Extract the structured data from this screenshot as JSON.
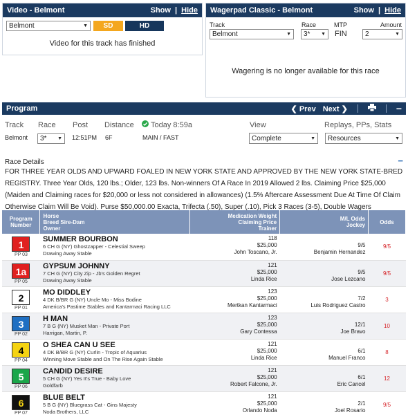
{
  "video": {
    "title": "Video - Belmont",
    "show": "Show",
    "sep": "|",
    "hide": "Hide",
    "track_select": "Belmont",
    "sd": "SD",
    "hd": "HD",
    "status": "Video for this track has finished"
  },
  "wager": {
    "title": "Wagerpad Classic - Belmont",
    "show": "Show",
    "sep": "|",
    "hide": "Hide",
    "track_label": "Track",
    "track_value": "Belmont",
    "race_label": "Race",
    "race_value": "3*",
    "mtp_label": "MTP",
    "mtp_value": "FIN",
    "amount_label": "Amount",
    "amount_value": "2",
    "status": "Wagering is no longer available for this race"
  },
  "program": {
    "title": "Program",
    "prev": "Prev",
    "next": "Next",
    "track_label": "Track",
    "race_label": "Race",
    "post_label": "Post",
    "distance_label": "Distance",
    "today_label": "Today 8:59a",
    "view_label": "View",
    "replays_label": "Replays, PPs, Stats",
    "track_value": "Belmont",
    "race_value": "3*",
    "post_value": "12:51PM",
    "distance_value": "6F",
    "surface_value": "MAIN / FAST",
    "view_value": "Complete",
    "resources_value": "Resources",
    "details_title": "Race Details",
    "details_lines": [
      "FOR THREE YEAR OLDS AND UPWARD FOALED IN NEW YORK STATE AND APPROVED BY THE NEW YORK STATE-BRED",
      "REGISTRY. Three Year Olds, 120 lbs.; Older, 123 lbs. Non-winners Of A Race In 2019 Allowed 2 lbs. Claiming Price $25,000",
      "(Maiden and Claiming races for $20,000 or less not considered in allowances) (1.5% Aftercare Assessment Due At Time Of Claim",
      "Otherwise Claim Will Be Void). Purse $50,000.00 Exacta, Trifecta (.50), Super (.10), Pick 3 Races (3-5), Double Wagers"
    ],
    "headers": {
      "program": "Program",
      "number": "Number",
      "horse": "Horse",
      "breed": "Breed Sire-Dam",
      "owner": "Owner",
      "med": "Medication Weight",
      "claim": "Claiming Price",
      "trainer": "Trainer",
      "ml": "M/L Odds",
      "jockey": "Jockey",
      "odds": "Odds"
    },
    "entries": [
      {
        "num": "1",
        "pp": "PP 03",
        "name": "SUMMER BOURBON",
        "breed": "6 CH G (NY) Ghostzapper - Celestial Sweep",
        "owner": "Drawing Away Stable",
        "weight": "118",
        "claim": "$25,000",
        "trainer": "John Toscano, Jr.",
        "ml": "9/5",
        "jockey": "Benjamin Hernandez",
        "odds": "9/5",
        "bg": "#e0201f",
        "fg": "#ffffff"
      },
      {
        "num": "1a",
        "pp": "PP 05",
        "name": "GYPSUM JOHNNY",
        "breed": "7 CH G (NY) City Zip - Jb's Golden Regret",
        "owner": "Drawing Away Stable",
        "weight": "121",
        "claim": "$25,000",
        "trainer": "Linda Rice",
        "ml": "9/5",
        "jockey": "Jose Lezcano",
        "odds": "9/5",
        "bg": "#e0201f",
        "fg": "#ffffff"
      },
      {
        "num": "2",
        "pp": "PP 01",
        "name": "MO DIDDLEY",
        "breed": "4 DK B/BR G (NY) Uncle Mo - Miss Bodine",
        "owner": "America's Pastime Stables and Kantarmaci Racing LLC",
        "weight": "123",
        "claim": "$25,000",
        "trainer": "Mertkan Kantarmaci",
        "ml": "7/2",
        "jockey": "Luis Rodriguez Castro",
        "odds": "3",
        "bg": "#ffffff",
        "fg": "#000000"
      },
      {
        "num": "3",
        "pp": "PP 02",
        "name": "H MAN",
        "breed": "7 B G (NY) Musket Man - Private Port",
        "owner": "Harrigan, Martin, P.",
        "weight": "123",
        "claim": "$25,000",
        "trainer": "Gary Contessa",
        "ml": "12/1",
        "jockey": "Joe Bravo",
        "odds": "10",
        "bg": "#1f6fc2",
        "fg": "#ffffff"
      },
      {
        "num": "4",
        "pp": "PP 04",
        "name": "O SHEA CAN U SEE",
        "breed": "4 DK B/BR G (NY) Curlin - Tropic of Aquarius",
        "owner": "Winning Move Stable and On The Rise Again Stable",
        "weight": "121",
        "claim": "$25,000",
        "trainer": "Linda Rice",
        "ml": "6/1",
        "jockey": "Manuel Franco",
        "odds": "8",
        "bg": "#f5d312",
        "fg": "#000000"
      },
      {
        "num": "5",
        "pp": "PP 06",
        "name": "CANDID DESIRE",
        "breed": "5 CH G (NY) Yes It's True - Baby Love",
        "owner": "Goldfarb",
        "weight": "121",
        "claim": "$25,000",
        "trainer": "Robert Falcone, Jr.",
        "ml": "6/1",
        "jockey": "Eric Cancel",
        "odds": "12",
        "bg": "#1aa64a",
        "fg": "#ffffff"
      },
      {
        "num": "6",
        "pp": "PP 07",
        "name": "BLUE BELT",
        "breed": "5 B G (NY) Bluegrass Cat - Gins Majesty",
        "owner": "Noda Brothers, LLC",
        "weight": "121",
        "claim": "$25,000",
        "trainer": "Orlando Noda",
        "ml": "2/1",
        "jockey": "Joel Rosario",
        "odds": "9/5",
        "bg": "#111111",
        "fg": "#f5d312"
      }
    ]
  },
  "colors": {
    "header_navy": "#1b3a60",
    "table_header": "#7d93b8",
    "odds_red": "#d6252a",
    "sd_orange": "#f4a71e"
  }
}
